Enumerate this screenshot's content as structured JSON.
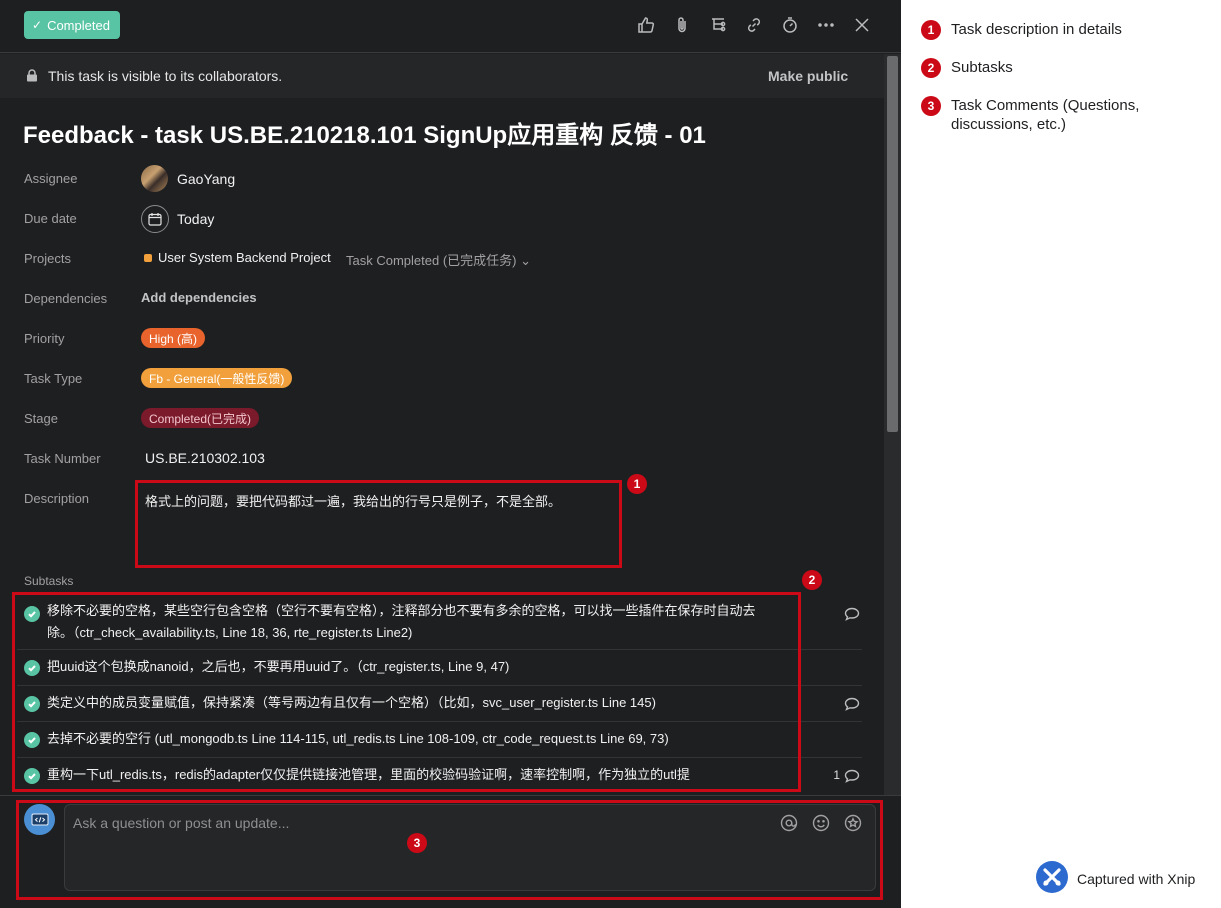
{
  "header": {
    "completed_label": "Completed",
    "icons": [
      "thumbs-up-icon",
      "paperclip-icon",
      "subtask-icon",
      "link-icon",
      "timer-icon",
      "more-icon",
      "close-icon"
    ]
  },
  "visibility": {
    "text": "This task is visible to its collaborators.",
    "make_public": "Make public"
  },
  "task": {
    "title": "Feedback - task US.BE.210218.101 SignUp应用重构 反馈 - 01",
    "fields": {
      "assignee_label": "Assignee",
      "assignee": "GaoYang",
      "due_label": "Due date",
      "due": "Today",
      "projects_label": "Projects",
      "project": "User System Backend Project",
      "project_section": "Task Completed (已完成任务)",
      "dependencies_label": "Dependencies",
      "add_dependencies": "Add dependencies",
      "priority_label": "Priority",
      "priority": "High (高)",
      "task_type_label": "Task Type",
      "task_type": "Fb - General(一般性反馈)",
      "stage_label": "Stage",
      "stage": "Completed(已完成)",
      "task_number_label": "Task Number",
      "task_number": "US.BE.210302.103",
      "description_label": "Description",
      "description": "格式上的问题，要把代码都过一遍，我给出的行号只是例子，不是全部。"
    },
    "colors": {
      "priority": "#e8642c",
      "task_type": "#f1a03b",
      "stage": "#7a1a2a",
      "completed": "#58c4a3",
      "project_dot": "#f1a03b"
    }
  },
  "subtasks": {
    "label": "Subtasks",
    "items": [
      {
        "text": "移除不必要的空格，某些空行包含空格（空行不要有空格），注释部分也不要有多余的空格，可以找一些插件在保存时自动去除。（ctr_check_availability.ts, Line 18, 36,  rte_register.ts Line2)",
        "has_comment": true,
        "comment_count": ""
      },
      {
        "text": "把uuid这个包换成nanoid，之后也，不要再用uuid了。（ctr_register.ts, Line 9, 47)",
        "has_comment": false,
        "comment_count": ""
      },
      {
        "text": "类定义中的成员变量赋值，保持紧凑（等号两边有且仅有一个空格）（比如，svc_user_register.ts Line 145)",
        "has_comment": true,
        "comment_count": ""
      },
      {
        "text": "去掉不必要的空行 (utl_mongodb.ts Line 114-115, utl_redis.ts Line 108-109, ctr_code_request.ts Line 69, 73)",
        "has_comment": false,
        "comment_count": ""
      },
      {
        "text": "重构一下utl_redis.ts，redis的adapter仅仅提供链接池管理，里面的校验码验证啊，速率控制啊，作为独立的utl提",
        "has_comment": true,
        "comment_count": "1"
      }
    ]
  },
  "comment": {
    "placeholder": "Ask a question or post an update...",
    "icons": [
      "mention-icon",
      "emoji-icon",
      "star-icon"
    ]
  },
  "annotations": {
    "badges": [
      "1",
      "2",
      "3"
    ],
    "color": "#cc0a17"
  },
  "legend": {
    "items": [
      {
        "num": "1",
        "text": "Task description in details"
      },
      {
        "num": "2",
        "text": "Subtasks"
      },
      {
        "num": "3",
        "text": "Task Comments (Questions, discussions, etc.)"
      }
    ],
    "captured": "Captured with Xnip"
  }
}
